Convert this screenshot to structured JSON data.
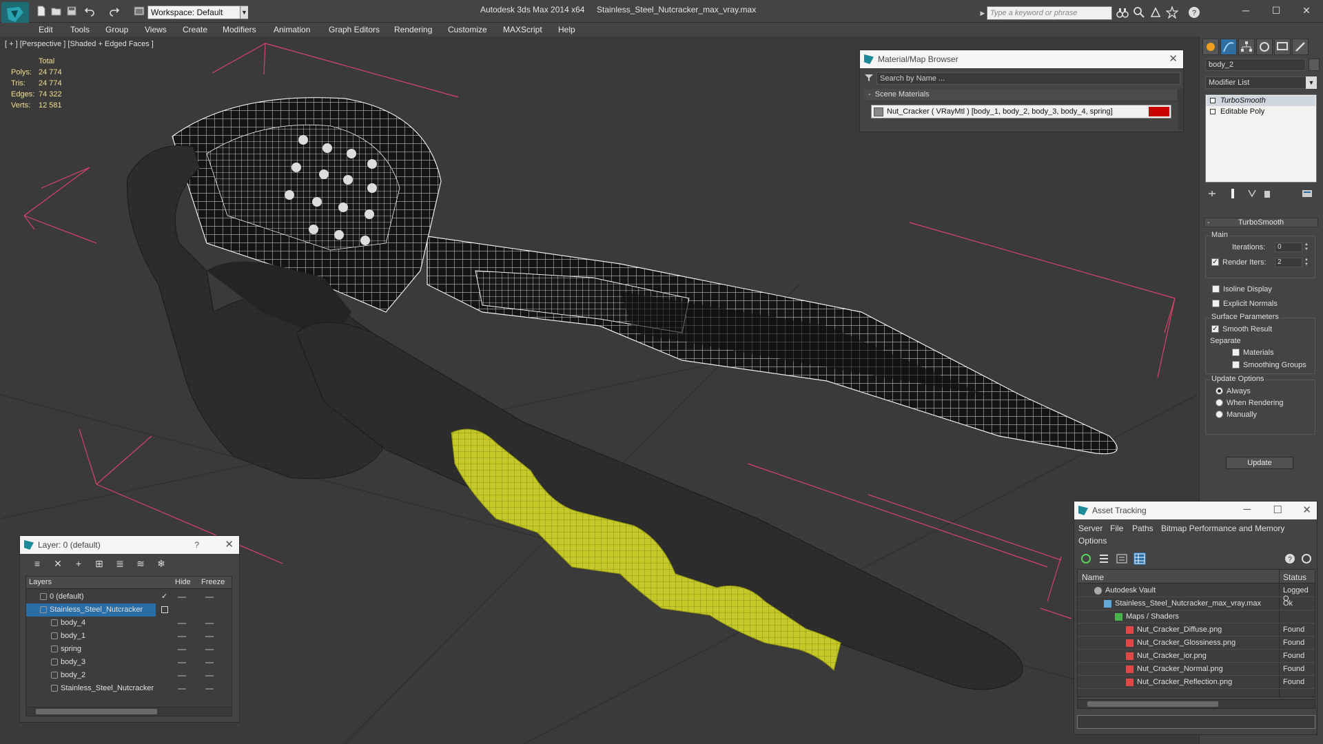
{
  "titlebar": {
    "workspace": "Workspace: Default",
    "app_title": "Autodesk 3ds Max  2014 x64",
    "file_title": "Stainless_Steel_Nutcracker_max_vray.max",
    "search_placeholder": "Type a keyword or phrase"
  },
  "menu": [
    "Edit",
    "Tools",
    "Group",
    "Views",
    "Create",
    "Modifiers",
    "Animation",
    "Graph Editors",
    "Rendering",
    "Customize",
    "MAXScript",
    "Help"
  ],
  "viewport": {
    "label": "[ + ] [Perspective ] [Shaded + Edged Faces ]",
    "stats": {
      "header": "Total",
      "polys_label": "Polys:",
      "polys": "24 774",
      "tris_label": "Tris:",
      "tris": "24 774",
      "edges_label": "Edges:",
      "edges": "74 322",
      "verts_label": "Verts:",
      "verts": "12 581"
    }
  },
  "material_browser": {
    "title": "Material/Map Browser",
    "search_placeholder": "Search by Name ...",
    "section": "Scene Materials",
    "item": "Nut_Cracker ( VRayMtl ) [body_1, body_2, body_3, body_4, spring]",
    "swatch_color": "#c80000"
  },
  "command_panel": {
    "object_name": "body_2",
    "modifier_list": "Modifier List",
    "stack": [
      "TurboSmooth",
      "Editable Poly"
    ],
    "rollout": {
      "title": "TurboSmooth",
      "main": "Main",
      "iterations_label": "Iterations:",
      "iterations": "0",
      "render_iters_label": "Render Iters:",
      "render_iters": "2",
      "isoline": "Isoline Display",
      "explicit": "Explicit Normals",
      "surface": "Surface Parameters",
      "smooth_result": "Smooth Result",
      "separate": "Separate",
      "materials": "Materials",
      "smoothing_groups": "Smoothing Groups",
      "update_options": "Update Options",
      "always": "Always",
      "when_rendering": "When Rendering",
      "manually": "Manually",
      "update": "Update"
    }
  },
  "layer_dialog": {
    "title": "Layer: 0 (default)",
    "help": "?",
    "columns": [
      "Layers",
      "Hide",
      "Freeze"
    ],
    "rows": [
      "0 (default)",
      "Stainless_Steel_Nutcracker",
      "body_4",
      "body_1",
      "spring",
      "body_3",
      "body_2",
      "Stainless_Steel_Nutcracker"
    ]
  },
  "asset_tracking": {
    "title": "Asset Tracking",
    "menu_row1": [
      "Server",
      "File",
      "Paths",
      "Bitmap Performance and Memory"
    ],
    "menu_row2": [
      "Options"
    ],
    "columns": [
      "Name",
      "Status"
    ],
    "rows": [
      {
        "name": "Autodesk Vault",
        "status": "Logged O"
      },
      {
        "name": "Stainless_Steel_Nutcracker_max_vray.max",
        "status": "Ok"
      },
      {
        "name": "Maps / Shaders",
        "status": ""
      },
      {
        "name": "Nut_Cracker_Diffuse.png",
        "status": "Found"
      },
      {
        "name": "Nut_Cracker_Glossiness.png",
        "status": "Found"
      },
      {
        "name": "Nut_Cracker_ior.png",
        "status": "Found"
      },
      {
        "name": "Nut_Cracker_Normal.png",
        "status": "Found"
      },
      {
        "name": "Nut_Cracker_Reflection.png",
        "status": "Found"
      }
    ]
  },
  "colors": {
    "grip_yellow": "#c8cc28",
    "bbox_pink": "#d9426b",
    "selection_blue": "#2a6ea8"
  }
}
